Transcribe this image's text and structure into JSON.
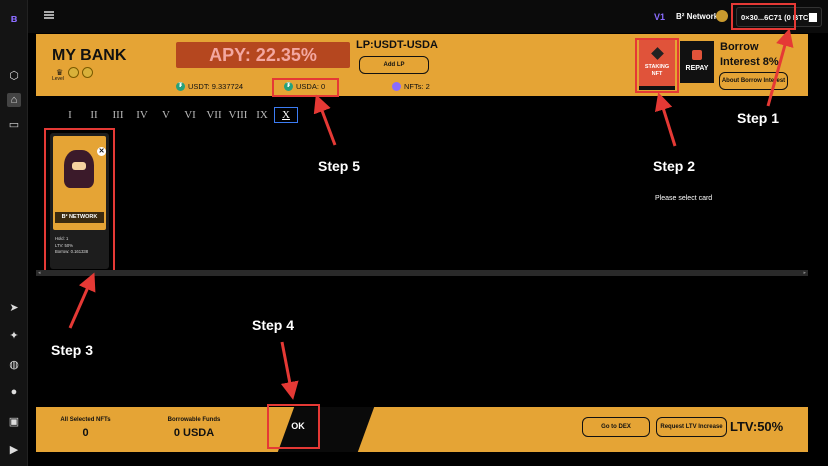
{
  "topbar": {
    "version": "V1",
    "network": "B² Network",
    "wallet": "0×30...6C71 (0 BTC)"
  },
  "header": {
    "title": "MY BANK",
    "level_label": "Level",
    "apy": "APY: 22.35%",
    "lp_title": "LP:USDT-USDA",
    "add_lp": "Add LP",
    "usdt": "USDT: 9.337724",
    "usda": "USDA: 0",
    "nfts": "NFTs: 2",
    "staking_label": "STAKING NFT",
    "repay_label": "REPAY",
    "borrow_title": "Borrow Interest 8%",
    "about_borrow": "About Borrow Interest"
  },
  "tabs": [
    "I",
    "II",
    "III",
    "IV",
    "V",
    "VI",
    "VII",
    "VIII",
    "IX",
    "X"
  ],
  "active_tab": "X",
  "card": {
    "name": "B² NETWORK",
    "hold": "Hold: 1",
    "ltv": "LTV: 50%",
    "borrow": "Borrow: 0.161338"
  },
  "select_message": "Please select card",
  "steps": {
    "step1": "Step 1",
    "step2": "Step 2",
    "step3": "Step 3",
    "step4": "Step 4",
    "step5": "Step 5"
  },
  "bottom": {
    "selected_label": "All Selected NFTs",
    "selected_value": "0",
    "borrowable_label": "Borrowable Funds",
    "borrowable_value": "0 USDA",
    "ok": "OK",
    "go_dex": "Go to DEX",
    "request_ltv": "Request LTV Increase",
    "ltv": "LTV:50%"
  },
  "colors": {
    "gold": "#e5a435",
    "annotation_red": "#e53935",
    "apy_box": "#b5471f",
    "staking": "#e0533a",
    "tab_active_border": "#3c7cf4"
  }
}
